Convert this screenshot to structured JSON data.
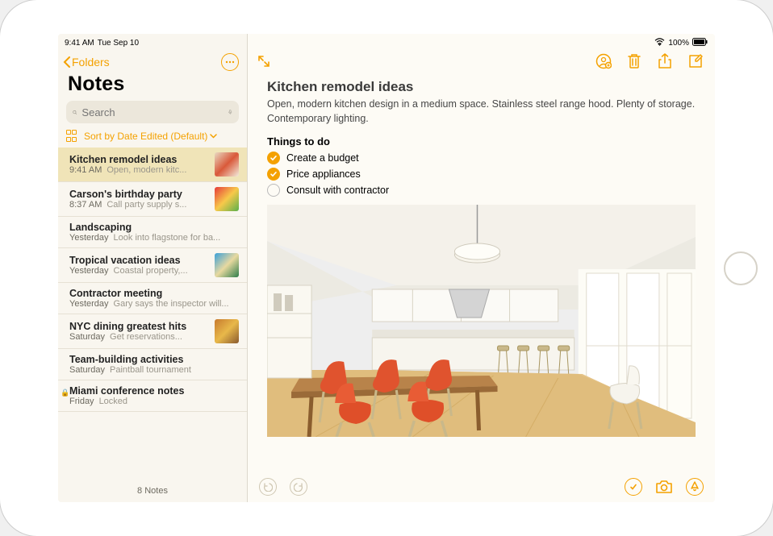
{
  "statusbar": {
    "time": "9:41 AM",
    "date": "Tue Sep 10",
    "battery": "100%"
  },
  "sidebar": {
    "back_label": "Folders",
    "title": "Notes",
    "search_placeholder": "Search",
    "sort_label": "Sort by Date Edited (Default)",
    "footer": "8 Notes",
    "items": [
      {
        "title": "Kitchen remodel ideas",
        "time": "9:41 AM",
        "preview": "Open, modern kitc...",
        "has_thumb": true,
        "selected": true,
        "locked": false
      },
      {
        "title": "Carson's birthday party",
        "time": "8:37 AM",
        "preview": "Call party supply s...",
        "has_thumb": true,
        "selected": false,
        "locked": false
      },
      {
        "title": "Landscaping",
        "time": "Yesterday",
        "preview": "Look into flagstone for ba...",
        "has_thumb": false,
        "selected": false,
        "locked": false
      },
      {
        "title": "Tropical vacation ideas",
        "time": "Yesterday",
        "preview": "Coastal property,...",
        "has_thumb": true,
        "selected": false,
        "locked": false
      },
      {
        "title": "Contractor meeting",
        "time": "Yesterday",
        "preview": "Gary says the inspector will...",
        "has_thumb": false,
        "selected": false,
        "locked": false
      },
      {
        "title": "NYC dining greatest hits",
        "time": "Saturday",
        "preview": "Get reservations...",
        "has_thumb": true,
        "selected": false,
        "locked": false
      },
      {
        "title": "Team-building activities",
        "time": "Saturday",
        "preview": "Paintball tournament",
        "has_thumb": false,
        "selected": false,
        "locked": false
      },
      {
        "title": "Miami conference notes",
        "time": "Friday",
        "preview": "Locked",
        "has_thumb": false,
        "selected": false,
        "locked": true
      }
    ]
  },
  "note": {
    "title": "Kitchen remodel ideas",
    "description": "Open, modern kitchen design in a medium space. Stainless steel range hood. Plenty of storage. Contemporary lighting.",
    "checklist_heading": "Things to do",
    "checklist": [
      {
        "label": "Create a budget",
        "checked": true
      },
      {
        "label": "Price appliances",
        "checked": true
      },
      {
        "label": "Consult with contractor",
        "checked": false
      }
    ]
  },
  "thumb_colors": {
    "kitchen": [
      "#e8d9c2",
      "#d9593a",
      "#f2ebdc"
    ],
    "party": [
      "#e63a3a",
      "#f7c94a",
      "#5bb04a"
    ],
    "tropical": [
      "#3aa0d9",
      "#e8d9a0",
      "#2e7d4a"
    ],
    "nyc": [
      "#c77a2e",
      "#e8b84a",
      "#8a5a2e"
    ]
  }
}
